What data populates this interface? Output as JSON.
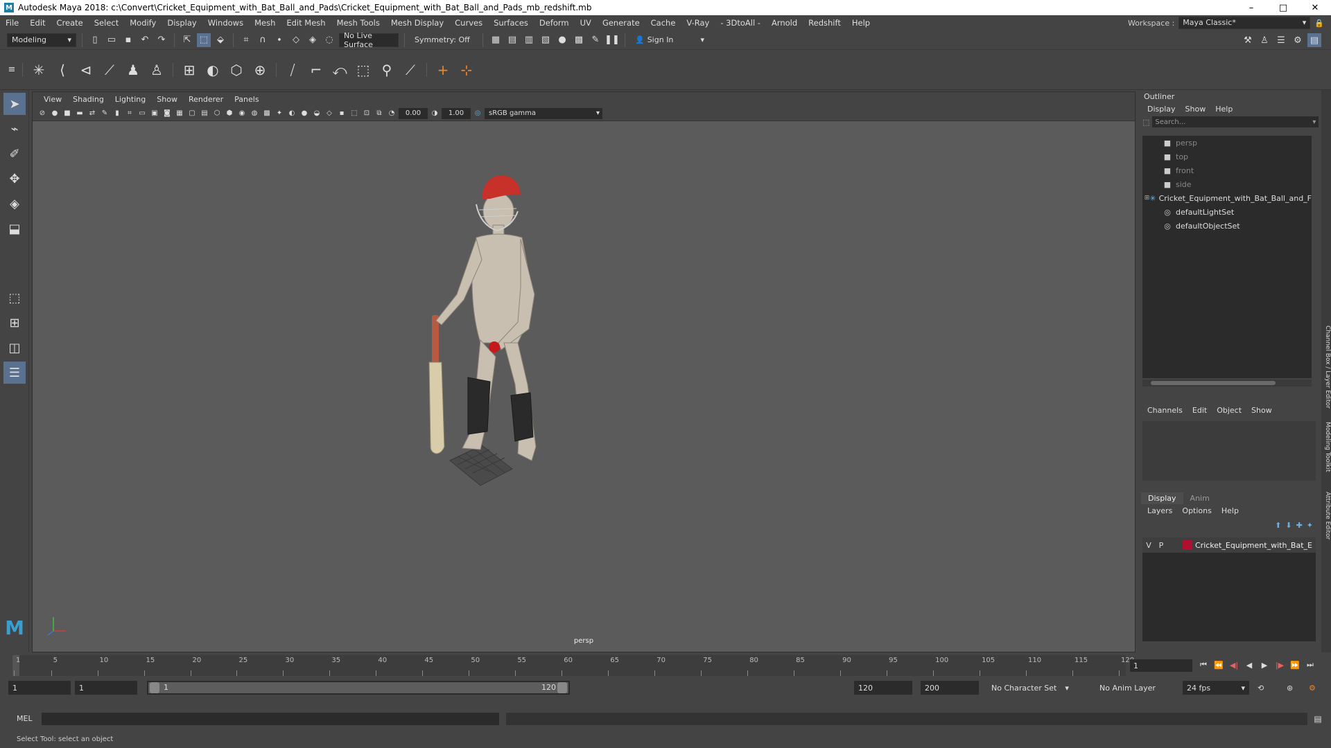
{
  "titlebar": {
    "logo": "M",
    "title": "Autodesk Maya 2018: c:\\Convert\\Cricket_Equipment_with_Bat_Ball_and_Pads\\Cricket_Equipment_with_Bat_Ball_and_Pads_mb_redshift.mb",
    "minimize": "–",
    "maximize": "□",
    "close": "✕"
  },
  "menubar": {
    "items": [
      "File",
      "Edit",
      "Create",
      "Select",
      "Modify",
      "Display",
      "Windows",
      "Mesh",
      "Edit Mesh",
      "Mesh Tools",
      "Mesh Display",
      "Curves",
      "Surfaces",
      "Deform",
      "UV",
      "Generate",
      "Cache",
      "V-Ray",
      "- 3DtoAll -",
      "Arnold",
      "Redshift",
      "Help"
    ],
    "workspace_label": "Workspace :",
    "workspace_value": "Maya Classic*"
  },
  "statusline": {
    "mode": "Modeling",
    "live_surface": "No Live Surface",
    "symmetry": "Symmetry: Off",
    "sign_in": "Sign In"
  },
  "viewport": {
    "menus": [
      "View",
      "Shading",
      "Lighting",
      "Show",
      "Renderer",
      "Panels"
    ],
    "exposure": "0.00",
    "gamma": "1.00",
    "color_space": "sRGB gamma",
    "camera": "persp"
  },
  "outliner": {
    "title": "Outliner",
    "menus": [
      "Display",
      "Show",
      "Help"
    ],
    "search_placeholder": "Search...",
    "items": [
      {
        "label": "persp",
        "icon": "camera-icon",
        "glyph": "■",
        "dim": true
      },
      {
        "label": "top",
        "icon": "camera-icon",
        "glyph": "■",
        "dim": true
      },
      {
        "label": "front",
        "icon": "camera-icon",
        "glyph": "■",
        "dim": true
      },
      {
        "label": "side",
        "icon": "camera-icon",
        "glyph": "■",
        "dim": true
      },
      {
        "label": "Cricket_Equipment_with_Bat_Ball_and_F",
        "icon": "group-icon",
        "glyph": "✳",
        "expander": "⊞",
        "dim": false
      },
      {
        "label": "defaultLightSet",
        "icon": "set-icon",
        "glyph": "◎",
        "dim": false
      },
      {
        "label": "defaultObjectSet",
        "icon": "set-icon",
        "glyph": "◎",
        "dim": false
      }
    ]
  },
  "channel_box": {
    "menus": [
      "Channels",
      "Edit",
      "Object",
      "Show"
    ]
  },
  "layer_editor": {
    "tabs": [
      "Display",
      "Anim"
    ],
    "menus": [
      "Layers",
      "Options",
      "Help"
    ],
    "layer": {
      "v": "V",
      "p": "P",
      "name": "Cricket_Equipment_with_Bat_E",
      "color": "#b01030"
    }
  },
  "side_tabs": [
    "Channel Box / Layer Editor",
    "Modeling Toolkit",
    "Attribute Editor"
  ],
  "timeline": {
    "ticks": [
      1,
      5,
      10,
      15,
      20,
      25,
      30,
      35,
      40,
      45,
      50,
      55,
      60,
      65,
      70,
      75,
      80,
      85,
      90,
      95,
      100,
      105,
      110,
      115,
      120
    ],
    "current_frame": "1"
  },
  "range": {
    "start": "1",
    "playback_start": "1",
    "slider_start": "1",
    "slider_end": "120",
    "playback_end": "120",
    "end": "200",
    "character_set": "No Character Set",
    "anim_layer": "No Anim Layer",
    "fps": "24 fps"
  },
  "command_line": {
    "label": "MEL"
  },
  "help_line": {
    "text": "Select Tool: select an object"
  }
}
